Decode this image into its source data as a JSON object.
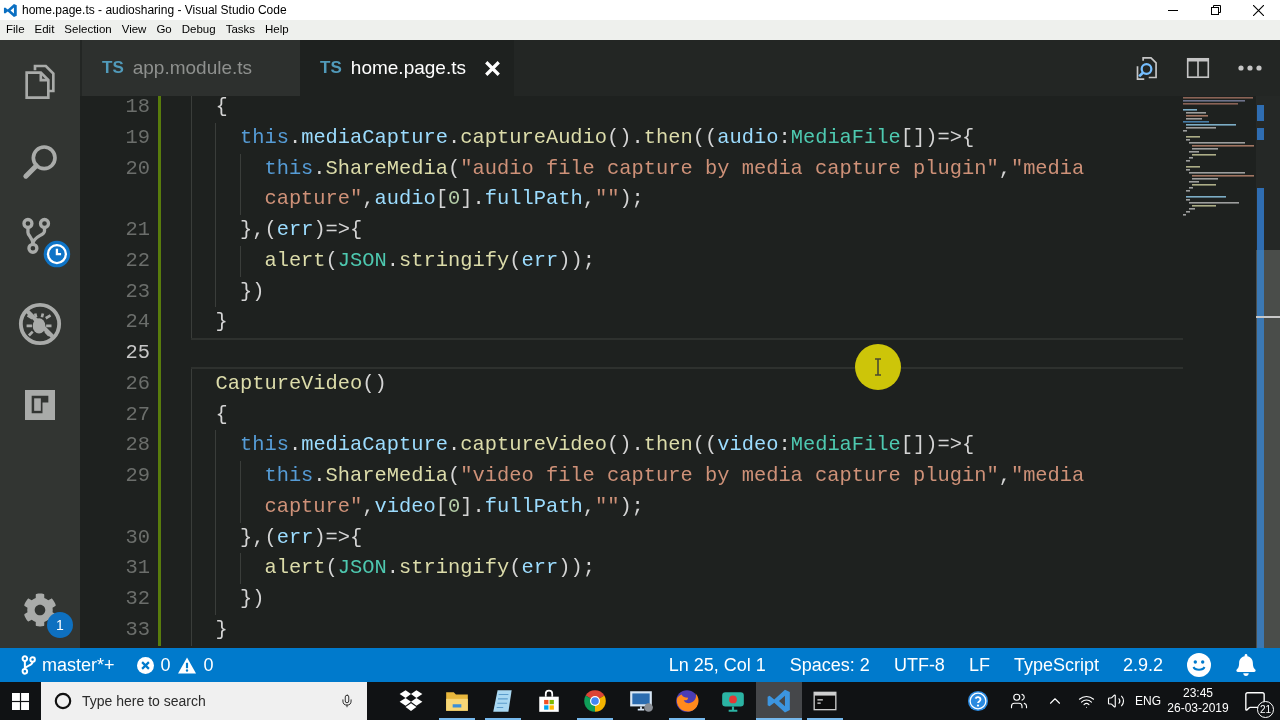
{
  "window": {
    "title": "home.page.ts - audiosharing - Visual Studio Code"
  },
  "menu": [
    "File",
    "Edit",
    "Selection",
    "View",
    "Go",
    "Debug",
    "Tasks",
    "Help"
  ],
  "activity_bar": {
    "settings_badge": "1"
  },
  "tabs": [
    {
      "file_type": "TS",
      "label": "app.module.ts",
      "selected": false
    },
    {
      "file_type": "TS",
      "label": "home.page.ts",
      "selected": true
    }
  ],
  "editor": {
    "lines": [
      {
        "number": "18",
        "current": false,
        "added": true,
        "tokens": [
          {
            "text": "  {",
            "kind": "plain"
          }
        ]
      },
      {
        "number": "19",
        "current": false,
        "added": true,
        "tokens": [
          {
            "text": "    this",
            "kind": "keyword"
          },
          {
            "text": ".",
            "kind": "plain"
          },
          {
            "text": "mediaCapture",
            "kind": "variable"
          },
          {
            "text": ".",
            "kind": "plain"
          },
          {
            "text": "captureAudio",
            "kind": "function"
          },
          {
            "text": "().",
            "kind": "plain"
          },
          {
            "text": "then",
            "kind": "function"
          },
          {
            "text": "((",
            "kind": "plain"
          },
          {
            "text": "audio",
            "kind": "variable"
          },
          {
            "text": ":",
            "kind": "plain"
          },
          {
            "text": "MediaFile",
            "kind": "type"
          },
          {
            "text": "[])=>{",
            "kind": "plain"
          }
        ]
      },
      {
        "number": "20",
        "current": false,
        "added": true,
        "tokens": [
          {
            "text": "      this",
            "kind": "keyword"
          },
          {
            "text": ".",
            "kind": "plain"
          },
          {
            "text": "ShareMedia",
            "kind": "function"
          },
          {
            "text": "(",
            "kind": "plain"
          },
          {
            "text": "\"audio file capture by media capture plugin\"",
            "kind": "string"
          },
          {
            "text": ",",
            "kind": "plain"
          },
          {
            "text": "\"media capture\"",
            "kind": "string"
          },
          {
            "text": ",",
            "kind": "plain"
          },
          {
            "text": "audio",
            "kind": "variable"
          },
          {
            "text": "[",
            "kind": "plain"
          },
          {
            "text": "0",
            "kind": "number"
          },
          {
            "text": "].",
            "kind": "plain"
          },
          {
            "text": "fullPath",
            "kind": "variable"
          },
          {
            "text": ",",
            "kind": "plain"
          },
          {
            "text": "\"\"",
            "kind": "string"
          },
          {
            "text": ");",
            "kind": "plain"
          }
        ]
      },
      {
        "number": "21",
        "current": false,
        "added": true,
        "tokens": [
          {
            "text": "    },(",
            "kind": "plain"
          },
          {
            "text": "err",
            "kind": "variable"
          },
          {
            "text": ")=>{",
            "kind": "plain"
          }
        ]
      },
      {
        "number": "22",
        "current": false,
        "added": true,
        "tokens": [
          {
            "text": "      alert",
            "kind": "function"
          },
          {
            "text": "(",
            "kind": "plain"
          },
          {
            "text": "JSON",
            "kind": "type"
          },
          {
            "text": ".",
            "kind": "plain"
          },
          {
            "text": "stringify",
            "kind": "function"
          },
          {
            "text": "(",
            "kind": "plain"
          },
          {
            "text": "err",
            "kind": "variable"
          },
          {
            "text": "));",
            "kind": "plain"
          }
        ]
      },
      {
        "number": "23",
        "current": false,
        "added": true,
        "tokens": [
          {
            "text": "    })",
            "kind": "plain"
          }
        ]
      },
      {
        "number": "24",
        "current": false,
        "added": true,
        "tokens": [
          {
            "text": "  }",
            "kind": "plain"
          }
        ]
      },
      {
        "number": "25",
        "current": true,
        "added": true
      },
      {
        "number": "26",
        "current": false,
        "added": true,
        "tokens": [
          {
            "text": "  CaptureVideo",
            "kind": "function"
          },
          {
            "text": "()",
            "kind": "plain"
          }
        ]
      },
      {
        "number": "27",
        "current": false,
        "added": true,
        "tokens": [
          {
            "text": "  {",
            "kind": "plain"
          }
        ]
      },
      {
        "number": "28",
        "current": false,
        "added": true,
        "tokens": [
          {
            "text": "    this",
            "kind": "keyword"
          },
          {
            "text": ".",
            "kind": "plain"
          },
          {
            "text": "mediaCapture",
            "kind": "variable"
          },
          {
            "text": ".",
            "kind": "plain"
          },
          {
            "text": "captureVideo",
            "kind": "function"
          },
          {
            "text": "().",
            "kind": "plain"
          },
          {
            "text": "then",
            "kind": "function"
          },
          {
            "text": "((",
            "kind": "plain"
          },
          {
            "text": "video",
            "kind": "variable"
          },
          {
            "text": ":",
            "kind": "plain"
          },
          {
            "text": "MediaFile",
            "kind": "type"
          },
          {
            "text": "[])=>{",
            "kind": "plain"
          }
        ]
      },
      {
        "number": "29",
        "current": false,
        "added": true,
        "tokens": [
          {
            "text": "      this",
            "kind": "keyword"
          },
          {
            "text": ".",
            "kind": "plain"
          },
          {
            "text": "ShareMedia",
            "kind": "function"
          },
          {
            "text": "(",
            "kind": "plain"
          },
          {
            "text": "\"video file capture by media capture plugin\"",
            "kind": "string"
          },
          {
            "text": ",",
            "kind": "plain"
          },
          {
            "text": "\"media capture\"",
            "kind": "string"
          },
          {
            "text": ",",
            "kind": "plain"
          },
          {
            "text": "video",
            "kind": "variable"
          },
          {
            "text": "[",
            "kind": "plain"
          },
          {
            "text": "0",
            "kind": "number"
          },
          {
            "text": "].",
            "kind": "plain"
          },
          {
            "text": "fullPath",
            "kind": "variable"
          },
          {
            "text": ",",
            "kind": "plain"
          },
          {
            "text": "\"\"",
            "kind": "string"
          },
          {
            "text": ");",
            "kind": "plain"
          }
        ]
      },
      {
        "number": "30",
        "current": false,
        "added": true,
        "tokens": [
          {
            "text": "    },(",
            "kind": "plain"
          },
          {
            "text": "err",
            "kind": "variable"
          },
          {
            "text": ")=>{",
            "kind": "plain"
          }
        ]
      },
      {
        "number": "31",
        "current": false,
        "added": true,
        "tokens": [
          {
            "text": "      alert",
            "kind": "function"
          },
          {
            "text": "(",
            "kind": "plain"
          },
          {
            "text": "JSON",
            "kind": "type"
          },
          {
            "text": ".",
            "kind": "plain"
          },
          {
            "text": "stringify",
            "kind": "function"
          },
          {
            "text": "(",
            "kind": "plain"
          },
          {
            "text": "err",
            "kind": "variable"
          },
          {
            "text": "));",
            "kind": "plain"
          }
        ]
      },
      {
        "number": "32",
        "current": false,
        "added": true,
        "tokens": [
          {
            "text": "    })",
            "kind": "plain"
          }
        ]
      },
      {
        "number": "33",
        "current": false,
        "added": true,
        "tokens": [
          {
            "text": "  }",
            "kind": "plain"
          }
        ]
      }
    ]
  },
  "status_bar": {
    "branch": "master*+",
    "errors": "0",
    "warnings": "0",
    "items": [
      "Ln 25, Col 1",
      "Spaces: 2",
      "UTF-8",
      "LF",
      "TypeScript",
      "2.9.2"
    ]
  },
  "taskbar": {
    "search": {
      "placeholder": "Type here to search"
    },
    "apps": [
      {
        "kind": "boxes",
        "running": false,
        "selected": false
      },
      {
        "kind": "folder",
        "running": true,
        "selected": false
      },
      {
        "kind": "notepad",
        "running": true,
        "selected": false
      },
      {
        "kind": "bag",
        "running": false,
        "selected": false
      },
      {
        "kind": "wheel",
        "running": true,
        "selected": false
      },
      {
        "kind": "screen",
        "running": false,
        "selected": false
      },
      {
        "kind": "globe",
        "running": true,
        "selected": false
      },
      {
        "kind": "recorder",
        "running": false,
        "selected": false
      },
      {
        "kind": "editor",
        "running": true,
        "selected": true
      },
      {
        "kind": "terminal",
        "running": true,
        "selected": false
      }
    ],
    "tray": {
      "language": "ENG",
      "time": "23:45",
      "date": "26-03-2019",
      "notifications": "21"
    }
  }
}
